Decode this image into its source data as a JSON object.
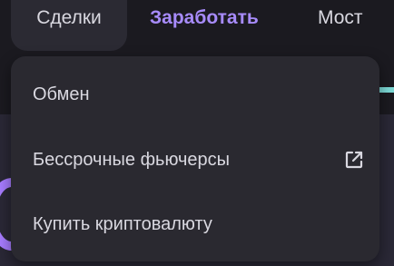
{
  "nav": {
    "items": [
      {
        "label": "Сделки",
        "active": true
      },
      {
        "label": "Заработать",
        "highlight_color": "#a78bfa"
      },
      {
        "label": "Мост"
      }
    ]
  },
  "dropdown": {
    "items": [
      {
        "label": "Обмен"
      },
      {
        "label": "Бессрочные фьючерсы",
        "icon": "external-link-icon"
      },
      {
        "label": "Купить криптовалюту"
      }
    ]
  },
  "colors": {
    "background": "#1b1a20",
    "dropdown_bg": "#2a2930",
    "accent": "#a78bfa",
    "text": "#d9d8e0"
  }
}
